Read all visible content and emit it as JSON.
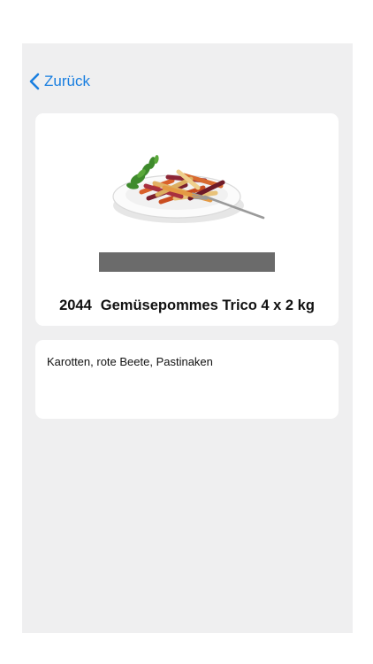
{
  "nav": {
    "back_label": "Zurück",
    "back_icon": "chevron-left-icon",
    "accent_color": "#1a7fe0"
  },
  "product": {
    "number": "2044",
    "name": "Gemüsepommes Trico 4 x 2 kg",
    "image": "plate-with-vegetable-fries-image"
  },
  "description": {
    "text": "Karotten, rote Beete, Pastinaken"
  }
}
